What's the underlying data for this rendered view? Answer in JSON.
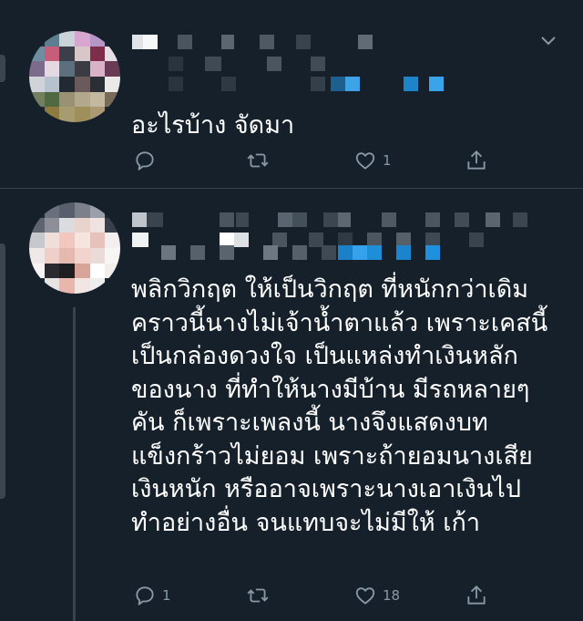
{
  "tweets": [
    {
      "text": "อะไรบ้าง จัดมา",
      "actions": {
        "reply_count": "",
        "retweet_count": "",
        "like_count": "1",
        "share_icon": "share-icon"
      }
    },
    {
      "text": "พลิกวิกฤต ให้เป็นวิกฤต ที่หนักกว่าเดิม\nคราวนี้นางไม่เจ้าน้ำตาแล้ว เพราะเคสนี้\nเป็นกล่องดวงใจ เป็นแหล่งทำเงินหลัก\nของนาง ที่ทำให้นางมีบ้าน มีรถหลายๆ\nคัน ก็เพราะเพลงนี้ นางจึงแสดงบท\nแข็งกร้าวไม่ยอม เพราะถ้ายอมนางเสีย\nเงินหนัก หรืออาจเพราะนางเอาเงินไป\nทำอย่างอื่น จนแทบจะไม่มีให้ เก้า",
      "actions": {
        "reply_count": "1",
        "retweet_count": "",
        "like_count": "18",
        "share_icon": "share-icon"
      }
    }
  ],
  "colors": {
    "background": "#15202b",
    "divider": "#38444d",
    "icon": "#8899a6",
    "text": "#ffffff",
    "link_blur": "#1da1f2"
  },
  "icons": [
    "reply-icon",
    "retweet-icon",
    "like-icon",
    "share-icon",
    "chevron-down-icon"
  ]
}
